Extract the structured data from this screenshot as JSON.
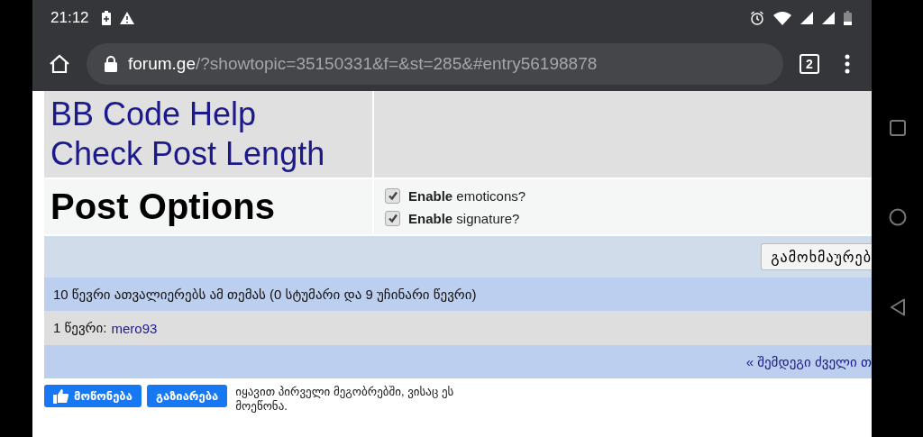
{
  "status_bar": {
    "time": "21:12"
  },
  "address_bar": {
    "domain": "forum.ge",
    "path": "/?showtopic=35150331&f=&st=285&#entry56198878",
    "tab_count": "2"
  },
  "help_links": [
    "BB Code Help",
    "Check Post Length"
  ],
  "post_options": {
    "title": "Post Options",
    "options": [
      {
        "label": "**Enable** emoticons?",
        "checked": true
      },
      {
        "label": "**Enable** signature?",
        "checked": true
      }
    ]
  },
  "reply_button": "გამოხმაურებ",
  "viewers": "10 წევრი ათვალიერებს ამ თემას (0 სტუმარი და 9 უჩინარი წევრი)",
  "members": {
    "label": "1 წევრი:",
    "names": [
      "mero93"
    ]
  },
  "nav_link": "« შემდეგი ძველი თ",
  "facebook": {
    "like": "მოწონება",
    "share": "გაზიარება",
    "text": "იყავით პირველი მეგობრებში, ვისაც ეს მოეწონა."
  }
}
